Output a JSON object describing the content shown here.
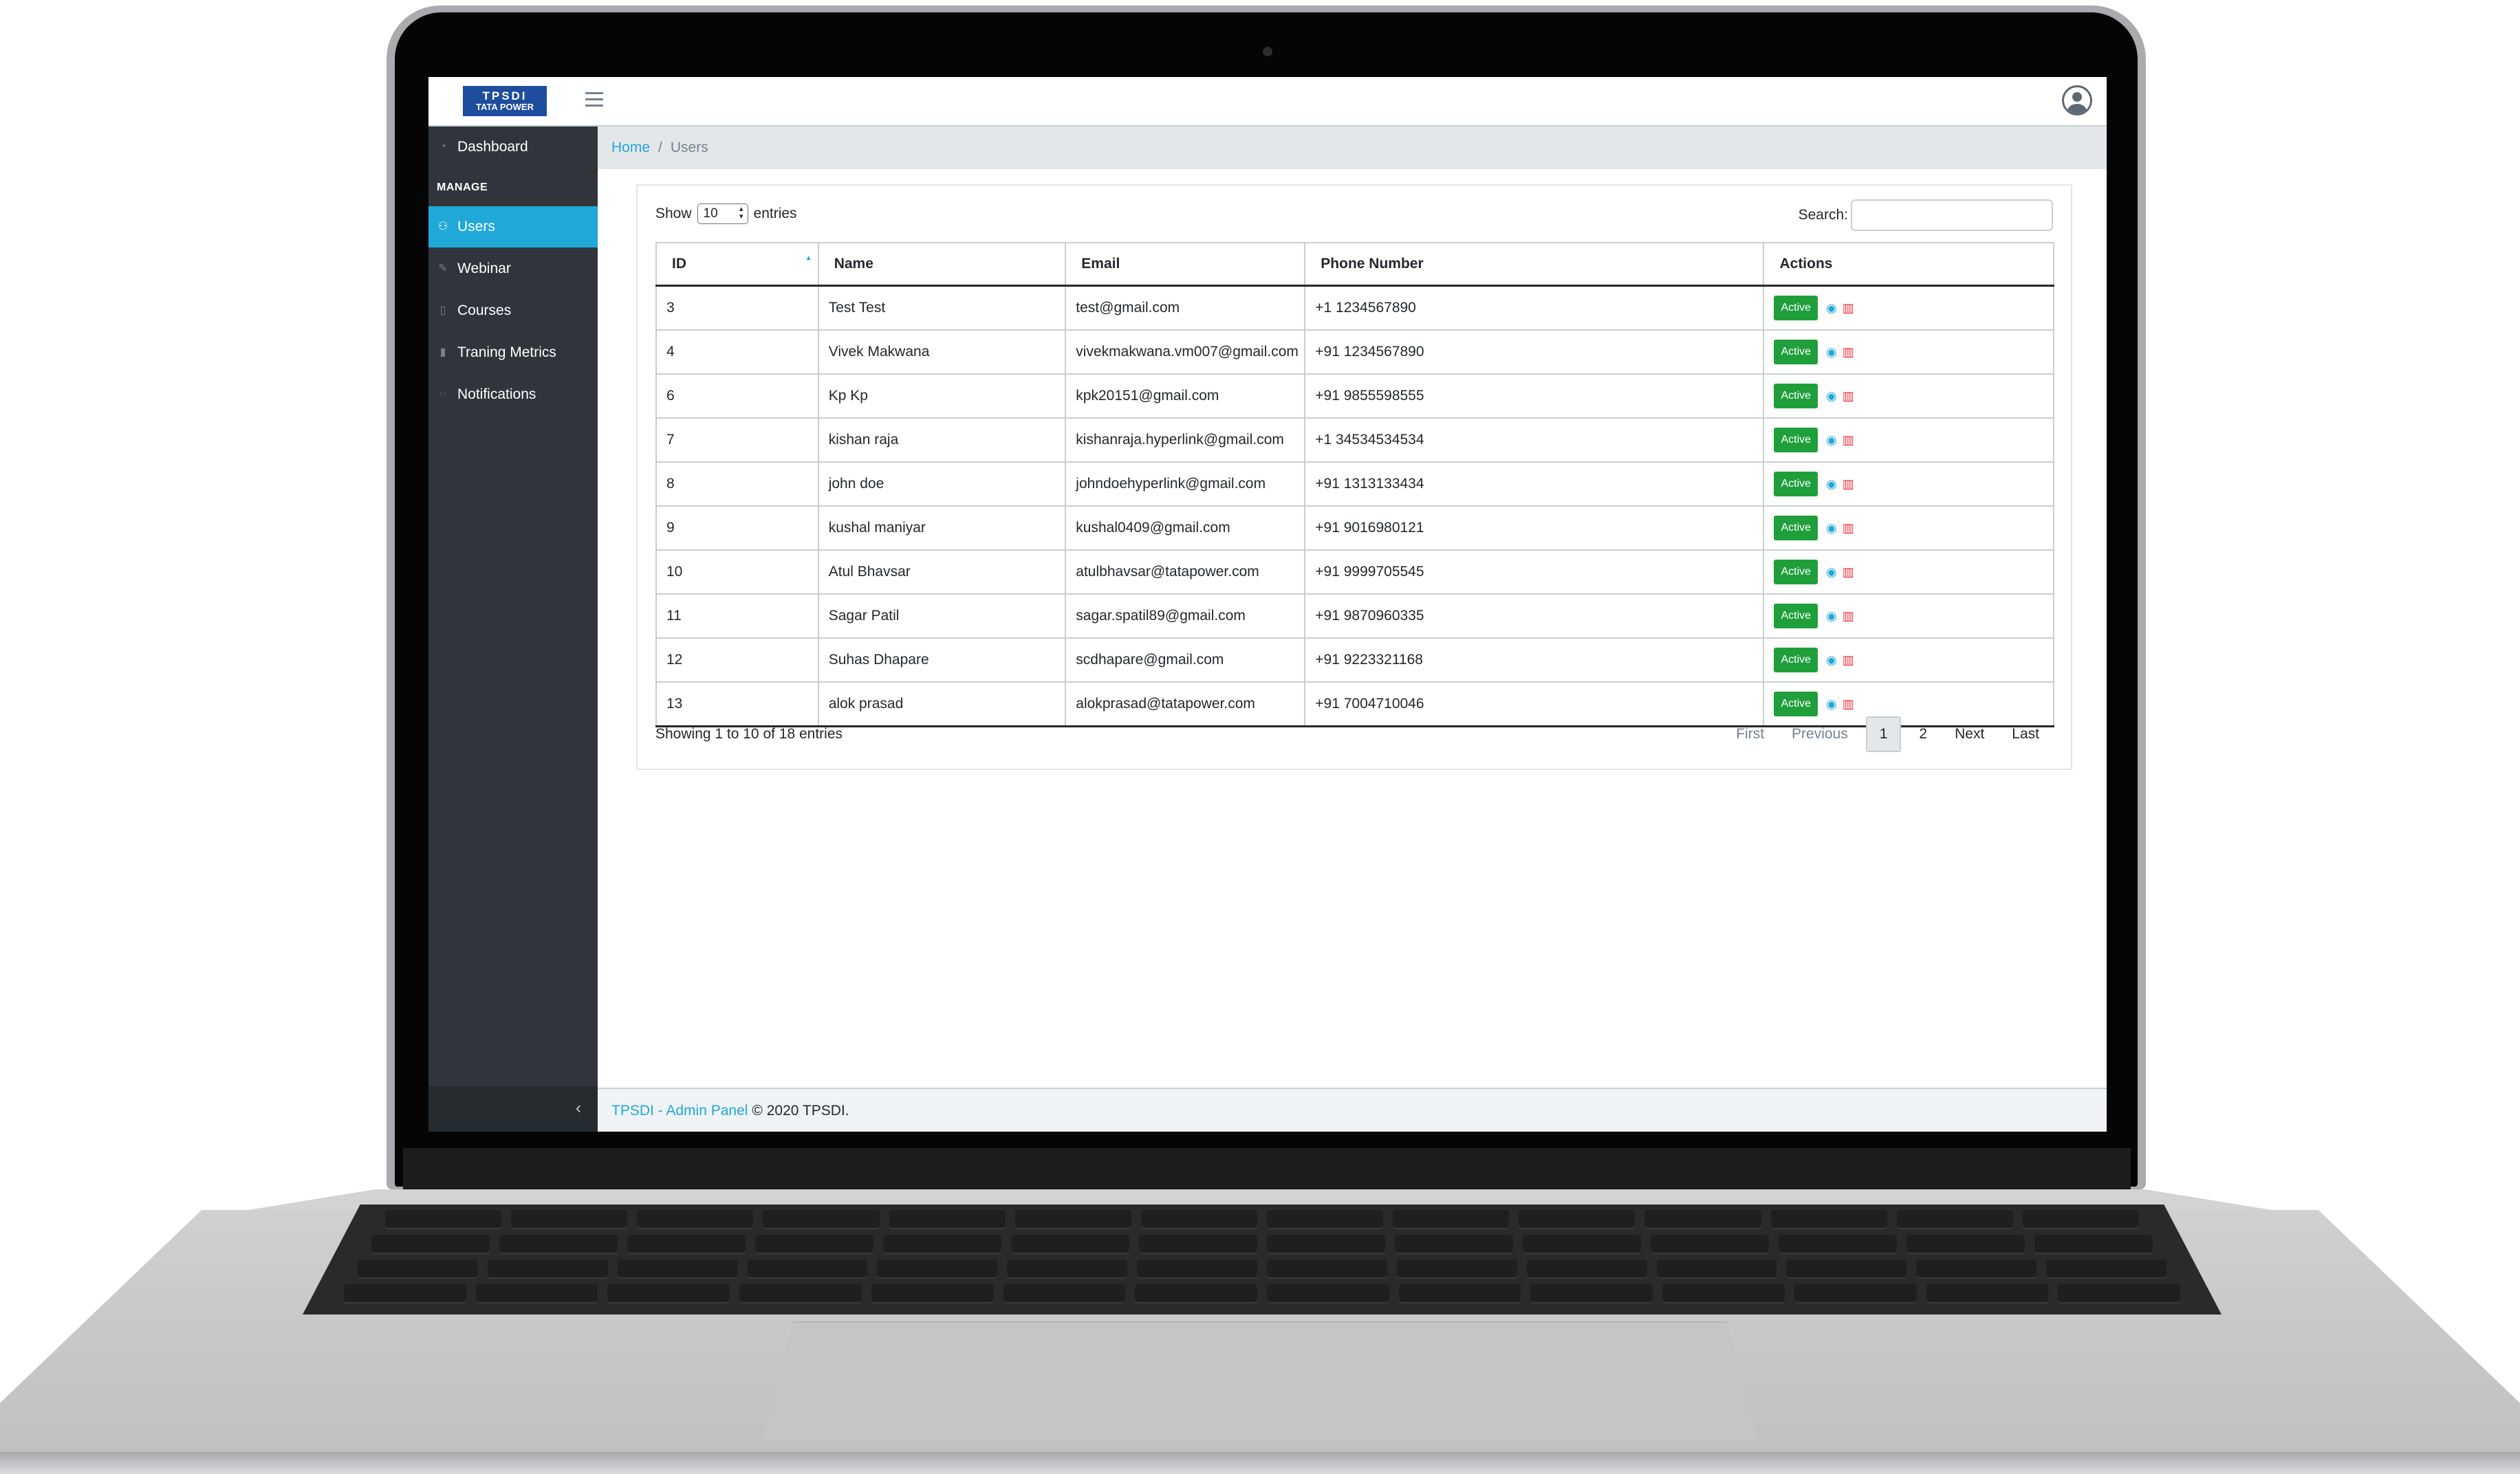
{
  "brand": {
    "logo_line1": "TPSDI",
    "logo_line2": "TATA POWER"
  },
  "header": {
    "menu_icon": "hamburger-icon",
    "user_icon": "user-circle-icon"
  },
  "sidebar": {
    "dashboard": "Dashboard",
    "section_title": "MANAGE",
    "items": [
      {
        "label": "Users",
        "icon": "user-icon",
        "active": true
      },
      {
        "label": "Webinar",
        "icon": "pencil-icon"
      },
      {
        "label": "Courses",
        "icon": "book-icon"
      },
      {
        "label": "Traning Metrics",
        "icon": "chart-icon"
      },
      {
        "label": "Notifications",
        "icon": "bell-icon"
      }
    ],
    "minimize_icon": "chevron-left-icon"
  },
  "breadcrumb": {
    "home": "Home",
    "separator": "/",
    "current": "Users"
  },
  "table_controls": {
    "show_label": "Show",
    "page_size": "10",
    "entries_label": "entries",
    "search_label": "Search:",
    "search_value": ""
  },
  "table": {
    "columns": [
      "ID",
      "Name",
      "Email",
      "Phone Number",
      "Actions"
    ],
    "rows": [
      [
        "3",
        "Test Test",
        "test@gmail.com",
        "+1 1234567890"
      ],
      [
        "4",
        "Vivek Makwana",
        "vivekmakwana.vm007@gmail.com",
        "+91 1234567890"
      ],
      [
        "6",
        "Kp Kp",
        "kpk20151@gmail.com",
        "+91 9855598555"
      ],
      [
        "7",
        "kishan raja",
        "kishanraja.hyperlink@gmail.com",
        "+1 34534534534"
      ],
      [
        "8",
        "john doe",
        "johndoehyperlink@gmail.com",
        "+91 1313133434"
      ],
      [
        "9",
        "kushal maniyar",
        "kushal0409@gmail.com",
        "+91 9016980121"
      ],
      [
        "10",
        "Atul Bhavsar",
        "atulbhavsar@tatapower.com",
        "+91 9999705545"
      ],
      [
        "11",
        "Sagar Patil",
        "sagar.spatil89@gmail.com",
        "+91 9870960335"
      ],
      [
        "12",
        "Suhas Dhapare",
        "scdhapare@gmail.com",
        "+91 9223321168"
      ],
      [
        "13",
        "alok prasad",
        "alokprasad@tatapower.com",
        "+91 7004710046"
      ]
    ],
    "status_label": "Active",
    "view_icon": "eye-icon",
    "delete_icon": "trash-icon"
  },
  "table_info": "Showing 1 to 10 of 18 entries",
  "pagination": {
    "first": "First",
    "previous": "Previous",
    "pages": [
      "1",
      "2"
    ],
    "current": "1",
    "next": "Next",
    "last": "Last"
  },
  "footer": {
    "link": "TPSDI - Admin Panel",
    "text": "© 2020 TPSDI."
  },
  "colors": {
    "accent": "#20a8d8",
    "sidebar": "#2f353a",
    "status_active": "#1e9f3c",
    "delete": "#e6353e"
  }
}
